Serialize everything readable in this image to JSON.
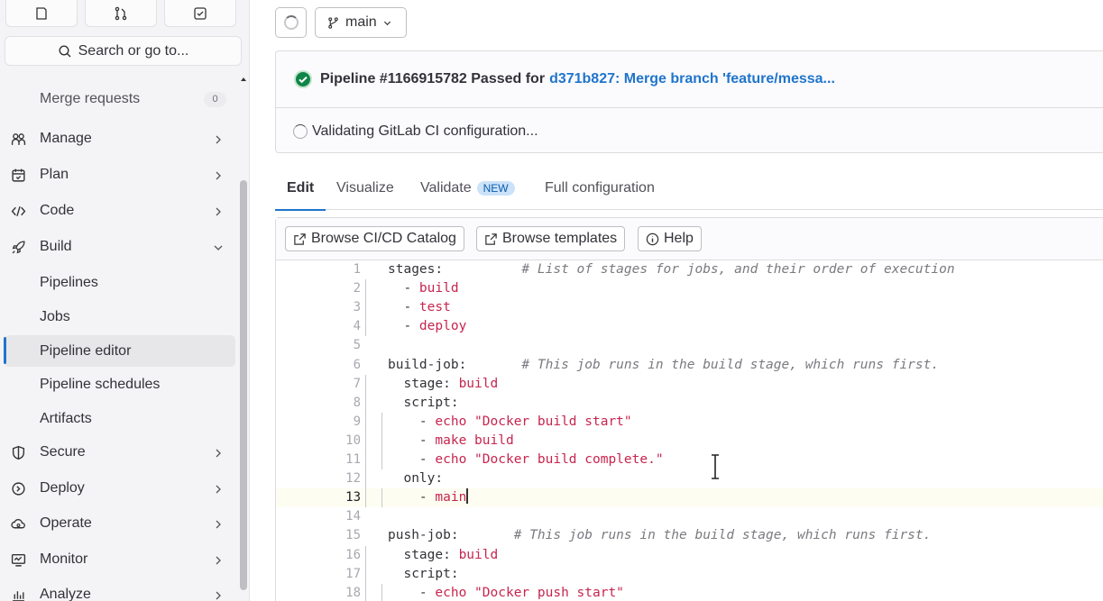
{
  "sidebar": {
    "search_placeholder": "Search or go to...",
    "merge_requests": {
      "label": "Merge requests",
      "count": "0"
    },
    "items": [
      {
        "label": "Manage",
        "icon": "users-icon"
      },
      {
        "label": "Plan",
        "icon": "calendar-icon"
      },
      {
        "label": "Code",
        "icon": "code-icon"
      },
      {
        "label": "Build",
        "icon": "rocket-icon",
        "expanded": true
      },
      {
        "label": "Secure",
        "icon": "shield-icon"
      },
      {
        "label": "Deploy",
        "icon": "deploy-icon"
      },
      {
        "label": "Operate",
        "icon": "cloud-icon"
      },
      {
        "label": "Monitor",
        "icon": "monitor-icon"
      },
      {
        "label": "Analyze",
        "icon": "chart-icon"
      }
    ],
    "build_children": [
      {
        "label": "Pipelines"
      },
      {
        "label": "Jobs"
      },
      {
        "label": "Pipeline editor",
        "active": true
      },
      {
        "label": "Pipeline schedules"
      },
      {
        "label": "Artifacts"
      }
    ]
  },
  "header": {
    "branch": "main"
  },
  "pipeline": {
    "status_text": "Pipeline #1166915782 Passed for",
    "commit_link": "d371b827: Merge branch 'feature/messa...",
    "validating": "Validating GitLab CI configuration...",
    "status_color": "#108548"
  },
  "tabs": [
    {
      "label": "Edit",
      "active": true
    },
    {
      "label": "Visualize"
    },
    {
      "label": "Validate",
      "badge": "NEW"
    },
    {
      "label": "Full configuration"
    }
  ],
  "toolbar": {
    "catalog": "Browse CI/CD Catalog",
    "templates": "Browse templates",
    "help": "Help"
  },
  "editor": {
    "current_line": 13,
    "lines": [
      {
        "n": "1",
        "parts": [
          [
            "k",
            "stages:"
          ],
          [
            "p",
            "          "
          ],
          [
            "c",
            "# List of stages for jobs, and their order of execution"
          ]
        ]
      },
      {
        "n": "2",
        "parts": [
          [
            "p",
            "  - "
          ],
          [
            "s",
            "build"
          ]
        ]
      },
      {
        "n": "3",
        "parts": [
          [
            "p",
            "  - "
          ],
          [
            "s",
            "test"
          ]
        ]
      },
      {
        "n": "4",
        "parts": [
          [
            "p",
            "  - "
          ],
          [
            "s",
            "deploy"
          ]
        ]
      },
      {
        "n": "5",
        "parts": []
      },
      {
        "n": "6",
        "parts": [
          [
            "k",
            "build-job:"
          ],
          [
            "p",
            "       "
          ],
          [
            "c",
            "# This job runs in the build stage, which runs first."
          ]
        ]
      },
      {
        "n": "7",
        "parts": [
          [
            "p",
            "  stage: "
          ],
          [
            "s",
            "build"
          ]
        ]
      },
      {
        "n": "8",
        "parts": [
          [
            "p",
            "  script:"
          ]
        ]
      },
      {
        "n": "9",
        "parts": [
          [
            "p",
            "    - "
          ],
          [
            "s",
            "echo \"Docker build start\""
          ]
        ]
      },
      {
        "n": "10",
        "parts": [
          [
            "p",
            "    - "
          ],
          [
            "s",
            "make build"
          ]
        ]
      },
      {
        "n": "11",
        "parts": [
          [
            "p",
            "    - "
          ],
          [
            "s",
            "echo \"Docker build complete.\""
          ]
        ]
      },
      {
        "n": "12",
        "parts": [
          [
            "p",
            "  only:"
          ]
        ]
      },
      {
        "n": "13",
        "parts": [
          [
            "p",
            "    - "
          ],
          [
            "s",
            "main"
          ]
        ]
      },
      {
        "n": "14",
        "parts": []
      },
      {
        "n": "15",
        "parts": [
          [
            "k",
            "push-job:"
          ],
          [
            "p",
            "       "
          ],
          [
            "c",
            "# This job runs in the build stage, which runs first."
          ]
        ]
      },
      {
        "n": "16",
        "parts": [
          [
            "p",
            "  stage: "
          ],
          [
            "s",
            "build"
          ]
        ]
      },
      {
        "n": "17",
        "parts": [
          [
            "p",
            "  script:"
          ]
        ]
      },
      {
        "n": "18",
        "parts": [
          [
            "p",
            "    - "
          ],
          [
            "s",
            "echo \"Docker push start\""
          ]
        ]
      }
    ]
  }
}
